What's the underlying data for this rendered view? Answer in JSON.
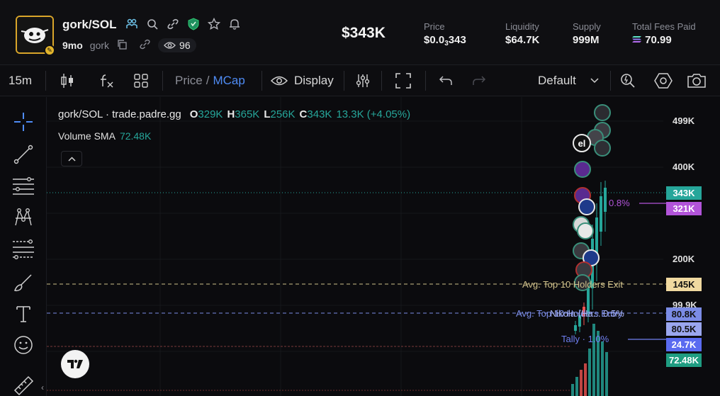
{
  "header": {
    "pair": "gork/SOL",
    "age": "9mo",
    "ticker": "gork",
    "viewers": "96",
    "market_cap": "$343K",
    "price_label": "Price",
    "price_prefix": "$0.0",
    "price_sub": "3",
    "price_suffix": "343",
    "liquidity_label": "Liquidity",
    "liquidity_value": "$64.7K",
    "supply_label": "Supply",
    "supply_value": "999M",
    "fees_label": "Total Fees Paid",
    "fees_value": "70.99",
    "accent_gold": "#d9a52a",
    "accent_teal": "#26a69a"
  },
  "toolbar": {
    "interval": "15m",
    "price": "Price",
    "slash": "/",
    "mcap": "MCap",
    "display": "Display",
    "template": "Default"
  },
  "chart": {
    "legend_pair": "gork/SOL · trade.padre.gg",
    "o_key": "O",
    "o_val": "329K",
    "h_key": "H",
    "h_val": "365K",
    "l_key": "L",
    "l_val": "256K",
    "c_key": "C",
    "c_val": "343K",
    "change": "13.3K (+4.05%)",
    "volume_label": "Volume SMA",
    "volume_value": "72.48K",
    "y_axis": [
      "499K",
      "400K",
      "200K",
      "99.9K"
    ],
    "tags": {
      "current": "343K",
      "purple": "321K",
      "top10": "145K",
      "blue1": "80.8K",
      "blue2": "80.5K",
      "blue3": "24.7K",
      "volume": "72.48K"
    },
    "lines": {
      "purple_pct": "0.8%",
      "top10_exit": "Avg. Top 10 Holders Exit",
      "top10_entry": "Avg. Top 10 Holders Entry",
      "nikola": "Nikola (Ha...",
      "nikola_pct": "0.5%",
      "tally": "Tally",
      "tally_pct": "1.0%"
    },
    "avatar_text": "el"
  },
  "colors": {
    "up": "#26a69a",
    "down": "#ef5350",
    "purple": "#9c27b0",
    "gold": "#f0d9a0",
    "blue": "#7b8ce6"
  }
}
